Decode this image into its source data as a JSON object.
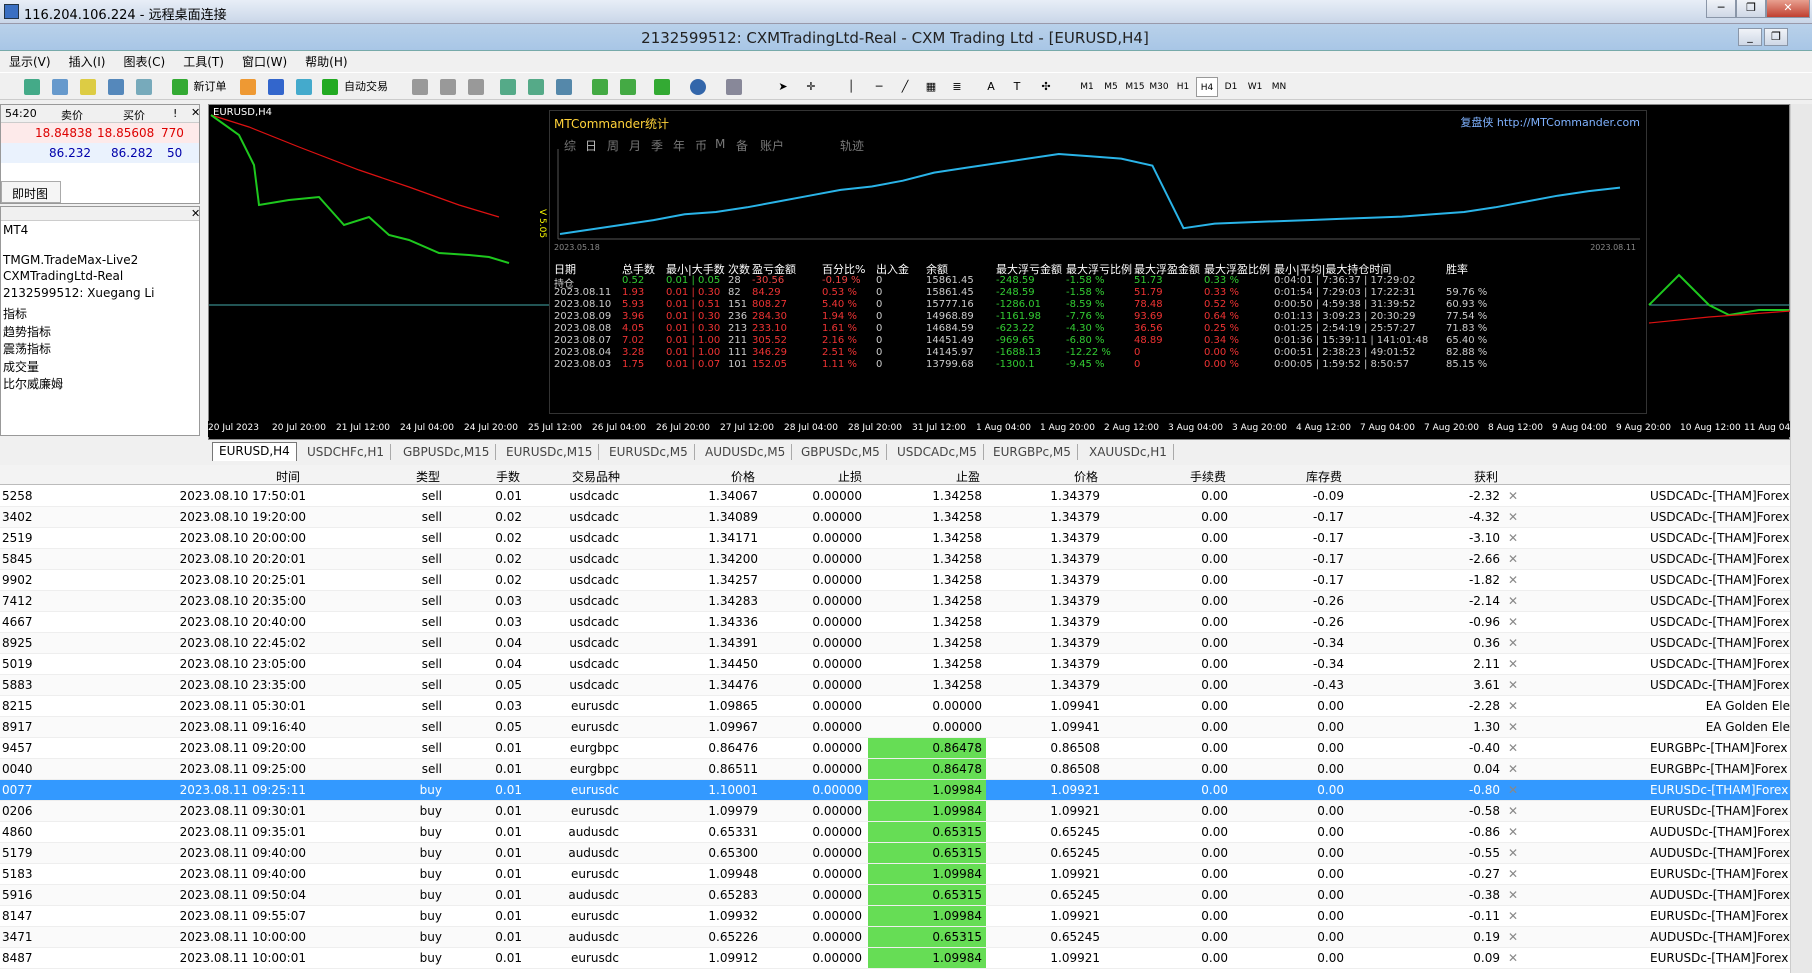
{
  "rdp": {
    "title": "116.204.106.224 - 远程桌面连接"
  },
  "window": {
    "title": "2132599512: CXMTradingLtd-Real - CXM Trading Ltd - [EURUSD,H4]"
  },
  "menu": [
    "显示(V)",
    "插入(I)",
    "图表(C)",
    "工具(T)",
    "窗口(W)",
    "帮助(H)"
  ],
  "toolbar": {
    "new_order": "新订单",
    "auto_trade": "自动交易",
    "timeframes": [
      "M1",
      "M5",
      "M15",
      "M30",
      "H1",
      "H4",
      "D1",
      "W1",
      "MN"
    ]
  },
  "market_watch": {
    "time": "54:20",
    "bid_label": "卖价",
    "ask_label": "买价",
    "spread_label": "!",
    "rows": [
      {
        "bid": "18.84838",
        "ask": "18.85608",
        "spread": "770"
      },
      {
        "bid": "86.232",
        "ask": "86.282",
        "spread": "50"
      }
    ],
    "tab": "即时图"
  },
  "navigator": {
    "items": [
      "MT4",
      "TMGM.TradeMax-Live2",
      "CXMTradingLtd-Real",
      "2132599512: Xuegang Li",
      "指标",
      "趋势指标",
      "震荡指标",
      "成交量",
      "比尔威廉姆"
    ]
  },
  "chart": {
    "symbol": "EURUSD,H4",
    "price_label": "V 5.05",
    "x_labels": [
      "20 Jul 2023",
      "20 Jul 20:00",
      "21 Jul 12:00",
      "24 Jul 04:00",
      "24 Jul 20:00",
      "25 Jul 12:00",
      "26 Jul 04:00",
      "26 Jul 20:00",
      "27 Jul 12:00",
      "28 Jul 04:00",
      "28 Jul 20:00",
      "31 Jul 12:00",
      "1 Aug 04:00",
      "1 Aug 20:00",
      "2 Aug 12:00",
      "3 Aug 04:00",
      "3 Aug 20:00",
      "4 Aug 12:00",
      "7 Aug 04:00",
      "7 Aug 20:00",
      "8 Aug 12:00",
      "9 Aug 04:00",
      "9 Aug 20:00",
      "10 Aug 12:00",
      "11 Aug 04"
    ]
  },
  "stats": {
    "title": "MTCommander统计",
    "link": "复盘侠 http://MTCommander.com",
    "tabs": [
      "综",
      "日",
      "周",
      "月",
      "季",
      "年",
      "币",
      "M",
      "备",
      "账户",
      "轨迹"
    ],
    "date_start": "2023.05.18",
    "date_end": "2023.08.11",
    "chart_data": {
      "type": "line",
      "values": [
        5,
        9,
        13,
        17,
        22,
        24,
        28,
        33,
        38,
        43,
        46,
        51,
        58,
        62,
        66,
        70,
        74,
        72,
        70,
        64,
        10,
        14,
        15,
        16,
        17,
        18,
        19,
        20,
        22,
        24,
        28,
        33,
        38,
        42,
        45
      ]
    },
    "headers": [
      "日期",
      "总手数",
      "最小|大手数",
      "次数",
      "盈亏金额",
      "百分比%",
      "出入金",
      "余额",
      "最大浮亏金额",
      "最大浮亏比例",
      "最大浮盈金额",
      "最大浮盈比例",
      "最小|平均|最大持仓时间",
      "胜率"
    ],
    "rows": [
      [
        "持仓",
        "0.52",
        "0.01 | 0.05",
        "28",
        "-30.56",
        "-0.19 %",
        "0",
        "15861.45",
        "-248.59",
        "-1.58 %",
        "51.73",
        "0.33 %",
        "0:04:01 | 7:36:37 | 17:29:02",
        ""
      ],
      [
        "2023.08.11",
        "1.93",
        "0.01 | 0.30",
        "82",
        "84.29",
        "0.53 %",
        "0",
        "15861.45",
        "-248.59",
        "-1.58 %",
        "51.79",
        "0.33 %",
        "0:01:54 | 7:29:03 | 17:22:31",
        "59.76 %"
      ],
      [
        "2023.08.10",
        "5.93",
        "0.01 | 0.51",
        "151",
        "808.27",
        "5.40 %",
        "0",
        "15777.16",
        "-1286.01",
        "-8.59 %",
        "78.48",
        "0.52 %",
        "0:00:50 | 4:59:38 | 31:39:52",
        "60.93 %"
      ],
      [
        "2023.08.09",
        "3.96",
        "0.01 | 0.30",
        "236",
        "284.30",
        "1.94 %",
        "0",
        "14968.89",
        "-1161.98",
        "-7.76 %",
        "93.69",
        "0.64 %",
        "0:01:13 | 3:09:23 | 20:30:29",
        "77.54 %"
      ],
      [
        "2023.08.08",
        "4.05",
        "0.01 | 0.30",
        "213",
        "233.10",
        "1.61 %",
        "0",
        "14684.59",
        "-623.22",
        "-4.30 %",
        "36.56",
        "0.25 %",
        "0:01:25 | 2:54:19 | 25:57:27",
        "71.83 %"
      ],
      [
        "2023.08.07",
        "7.02",
        "0.01 | 1.00",
        "211",
        "305.52",
        "2.16 %",
        "0",
        "14451.49",
        "-969.65",
        "-6.80 %",
        "48.89",
        "0.34 %",
        "0:01:36 | 15:39:11 | 141:01:48",
        "65.40 %"
      ],
      [
        "2023.08.04",
        "3.28",
        "0.01 | 1.00",
        "111",
        "346.29",
        "2.51 %",
        "0",
        "14145.97",
        "-1688.13",
        "-12.22 %",
        "0",
        "0.00 %",
        "0:00:51 | 2:38:23 | 49:01:52",
        "82.88 %"
      ],
      [
        "2023.08.03",
        "1.75",
        "0.01 | 0.07",
        "101",
        "152.05",
        "1.11 %",
        "0",
        "13799.68",
        "-1300.1",
        "-9.45 %",
        "0",
        "0.00 %",
        "0:00:05 | 1:59:52 | 8:50:57",
        "85.15 %"
      ]
    ]
  },
  "chart_tabs": [
    "EURUSD,H4",
    "USDCHFc,H1",
    "GBPUSDc,M15",
    "EURUSDc,M15",
    "EURUSDc,M5",
    "AUDUSDc,M5",
    "GBPUSDc,M5",
    "USDCADc,M5",
    "EURGBPc,M5",
    "XAUUSDc,H1"
  ],
  "grid": {
    "headers": [
      "时间",
      "类型",
      "手数",
      "交易品种",
      "价格",
      "止损",
      "止盈",
      "价格",
      "手续费",
      "库存费",
      "获利"
    ],
    "rows": [
      {
        "id": "5258",
        "time": "2023.08.10 17:50:01",
        "type": "sell",
        "lots": "0.01",
        "sym": "usdcadc",
        "price": "1.34067",
        "sl": "0.00000",
        "tp": "1.34258",
        "cur": "1.34379",
        "comm": "0.00",
        "swap": "-0.09",
        "profit": "-2.32",
        "comment": "USDCADc-[THAM]Forex Scal",
        "hl": false
      },
      {
        "id": "3402",
        "time": "2023.08.10 19:20:00",
        "type": "sell",
        "lots": "0.02",
        "sym": "usdcadc",
        "price": "1.34089",
        "sl": "0.00000",
        "tp": "1.34258",
        "cur": "1.34379",
        "comm": "0.00",
        "swap": "-0.17",
        "profit": "-4.32",
        "comment": "USDCADc-[THAM]Forex Scal",
        "hl": false
      },
      {
        "id": "2519",
        "time": "2023.08.10 20:00:00",
        "type": "sell",
        "lots": "0.02",
        "sym": "usdcadc",
        "price": "1.34171",
        "sl": "0.00000",
        "tp": "1.34258",
        "cur": "1.34379",
        "comm": "0.00",
        "swap": "-0.17",
        "profit": "-3.10",
        "comment": "USDCADc-[THAM]Forex Scal",
        "hl": false
      },
      {
        "id": "5845",
        "time": "2023.08.10 20:20:01",
        "type": "sell",
        "lots": "0.02",
        "sym": "usdcadc",
        "price": "1.34200",
        "sl": "0.00000",
        "tp": "1.34258",
        "cur": "1.34379",
        "comm": "0.00",
        "swap": "-0.17",
        "profit": "-2.66",
        "comment": "USDCADc-[THAM]Forex Scal",
        "hl": false
      },
      {
        "id": "9902",
        "time": "2023.08.10 20:25:01",
        "type": "sell",
        "lots": "0.02",
        "sym": "usdcadc",
        "price": "1.34257",
        "sl": "0.00000",
        "tp": "1.34258",
        "cur": "1.34379",
        "comm": "0.00",
        "swap": "-0.17",
        "profit": "-1.82",
        "comment": "USDCADc-[THAM]Forex Scal",
        "hl": false
      },
      {
        "id": "7412",
        "time": "2023.08.10 20:35:00",
        "type": "sell",
        "lots": "0.03",
        "sym": "usdcadc",
        "price": "1.34283",
        "sl": "0.00000",
        "tp": "1.34258",
        "cur": "1.34379",
        "comm": "0.00",
        "swap": "-0.26",
        "profit": "-2.14",
        "comment": "USDCADc-[THAM]Forex Scal",
        "hl": false
      },
      {
        "id": "4667",
        "time": "2023.08.10 20:40:00",
        "type": "sell",
        "lots": "0.03",
        "sym": "usdcadc",
        "price": "1.34336",
        "sl": "0.00000",
        "tp": "1.34258",
        "cur": "1.34379",
        "comm": "0.00",
        "swap": "-0.26",
        "profit": "-0.96",
        "comment": "USDCADc-[THAM]Forex Scal",
        "hl": false
      },
      {
        "id": "8925",
        "time": "2023.08.10 22:45:02",
        "type": "sell",
        "lots": "0.04",
        "sym": "usdcadc",
        "price": "1.34391",
        "sl": "0.00000",
        "tp": "1.34258",
        "cur": "1.34379",
        "comm": "0.00",
        "swap": "-0.34",
        "profit": "0.36",
        "comment": "USDCADc-[THAM]Forex Scalp",
        "hl": false
      },
      {
        "id": "5019",
        "time": "2023.08.10 23:05:00",
        "type": "sell",
        "lots": "0.04",
        "sym": "usdcadc",
        "price": "1.34450",
        "sl": "0.00000",
        "tp": "1.34258",
        "cur": "1.34379",
        "comm": "0.00",
        "swap": "-0.34",
        "profit": "2.11",
        "comment": "USDCADc-[THAM]Forex Scalp",
        "hl": false
      },
      {
        "id": "5883",
        "time": "2023.08.10 23:35:00",
        "type": "sell",
        "lots": "0.05",
        "sym": "usdcadc",
        "price": "1.34476",
        "sl": "0.00000",
        "tp": "1.34258",
        "cur": "1.34379",
        "comm": "0.00",
        "swap": "-0.43",
        "profit": "3.61",
        "comment": "USDCADc-[THAM]Forex Scalp",
        "hl": false
      },
      {
        "id": "8215",
        "time": "2023.08.11 05:30:01",
        "type": "sell",
        "lots": "0.03",
        "sym": "eurusdc",
        "price": "1.09865",
        "sl": "0.00000",
        "tp": "0.00000",
        "cur": "1.09941",
        "comm": "0.00",
        "swap": "0.00",
        "profit": "-2.28",
        "comment": "EA Golden Ele",
        "hl": false
      },
      {
        "id": "8917",
        "time": "2023.08.11 09:16:40",
        "type": "sell",
        "lots": "0.05",
        "sym": "eurusdc",
        "price": "1.09967",
        "sl": "0.00000",
        "tp": "0.00000",
        "cur": "1.09941",
        "comm": "0.00",
        "swap": "0.00",
        "profit": "1.30",
        "comment": "EA Golden Ele",
        "hl": false
      },
      {
        "id": "9457",
        "time": "2023.08.11 09:20:00",
        "type": "sell",
        "lots": "0.01",
        "sym": "eurgbpc",
        "price": "0.86476",
        "sl": "0.00000",
        "tp": "0.86478",
        "cur": "0.86508",
        "comm": "0.00",
        "swap": "0.00",
        "profit": "-0.40",
        "comment": "EURGBPc-[THAM]Forex Scal",
        "hl": true
      },
      {
        "id": "0040",
        "time": "2023.08.11 09:25:00",
        "type": "sell",
        "lots": "0.01",
        "sym": "eurgbpc",
        "price": "0.86511",
        "sl": "0.00000",
        "tp": "0.86478",
        "cur": "0.86508",
        "comm": "0.00",
        "swap": "0.00",
        "profit": "0.04",
        "comment": "EURGBPc-[THAM]Forex Scal",
        "hl": true
      },
      {
        "id": "0077",
        "time": "2023.08.11 09:25:11",
        "type": "buy",
        "lots": "0.01",
        "sym": "eurusdc",
        "price": "1.10001",
        "sl": "0.00000",
        "tp": "1.09984",
        "cur": "1.09921",
        "comm": "0.00",
        "swap": "0.00",
        "profit": "-0.80",
        "comment": "EURUSDc-[THAM]Forex Scal",
        "hl": true,
        "sel": true
      },
      {
        "id": "0206",
        "time": "2023.08.11 09:30:01",
        "type": "buy",
        "lots": "0.01",
        "sym": "eurusdc",
        "price": "1.09979",
        "sl": "0.00000",
        "tp": "1.09984",
        "cur": "1.09921",
        "comm": "0.00",
        "swap": "0.00",
        "profit": "-0.58",
        "comment": "EURUSDc-[THAM]Forex Scal",
        "hl": true
      },
      {
        "id": "4860",
        "time": "2023.08.11 09:35:01",
        "type": "buy",
        "lots": "0.01",
        "sym": "audusdc",
        "price": "0.65331",
        "sl": "0.00000",
        "tp": "0.65315",
        "cur": "0.65245",
        "comm": "0.00",
        "swap": "0.00",
        "profit": "-0.86",
        "comment": "AUDUSDc-[THAM]Forex Scal",
        "hl": true
      },
      {
        "id": "5179",
        "time": "2023.08.11 09:40:00",
        "type": "buy",
        "lots": "0.01",
        "sym": "audusdc",
        "price": "0.65300",
        "sl": "0.00000",
        "tp": "0.65315",
        "cur": "0.65245",
        "comm": "0.00",
        "swap": "0.00",
        "profit": "-0.55",
        "comment": "AUDUSDc-[THAM]Forex Scal",
        "hl": true
      },
      {
        "id": "5183",
        "time": "2023.08.11 09:40:00",
        "type": "buy",
        "lots": "0.01",
        "sym": "eurusdc",
        "price": "1.09948",
        "sl": "0.00000",
        "tp": "1.09984",
        "cur": "1.09921",
        "comm": "0.00",
        "swap": "0.00",
        "profit": "-0.27",
        "comment": "EURUSDc-[THAM]Forex Scal",
        "hl": true
      },
      {
        "id": "5916",
        "time": "2023.08.11 09:50:04",
        "type": "buy",
        "lots": "0.01",
        "sym": "audusdc",
        "price": "0.65283",
        "sl": "0.00000",
        "tp": "0.65315",
        "cur": "0.65245",
        "comm": "0.00",
        "swap": "0.00",
        "profit": "-0.38",
        "comment": "AUDUSDc-[THAM]Forex Scal",
        "hl": true
      },
      {
        "id": "8147",
        "time": "2023.08.11 09:55:07",
        "type": "buy",
        "lots": "0.01",
        "sym": "eurusdc",
        "price": "1.09932",
        "sl": "0.00000",
        "tp": "1.09984",
        "cur": "1.09921",
        "comm": "0.00",
        "swap": "0.00",
        "profit": "-0.11",
        "comment": "EURUSDc-[THAM]Forex Scal",
        "hl": true
      },
      {
        "id": "3471",
        "time": "2023.08.11 10:00:00",
        "type": "buy",
        "lots": "0.01",
        "sym": "audusdc",
        "price": "0.65226",
        "sl": "0.00000",
        "tp": "0.65315",
        "cur": "0.65245",
        "comm": "0.00",
        "swap": "0.00",
        "profit": "0.19",
        "comment": "AUDUSDc-[THAM]Forex Scal",
        "hl": true
      },
      {
        "id": "8487",
        "time": "2023.08.11 10:00:01",
        "type": "buy",
        "lots": "0.01",
        "sym": "eurusdc",
        "price": "1.09912",
        "sl": "0.00000",
        "tp": "1.09984",
        "cur": "1.09921",
        "comm": "0.00",
        "swap": "0.00",
        "profit": "0.09",
        "comment": "EURUSDc-[THAM]Forex Scal",
        "hl": true
      }
    ]
  }
}
